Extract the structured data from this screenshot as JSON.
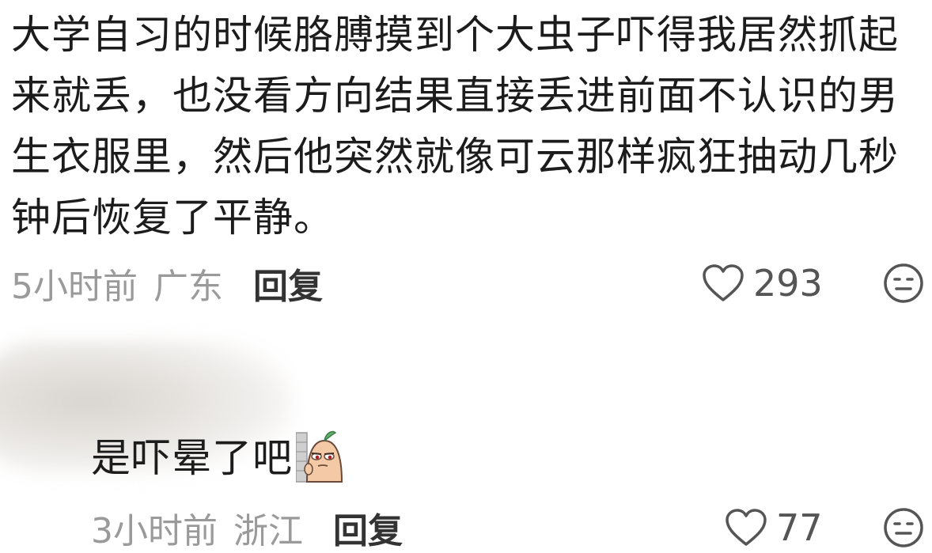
{
  "comment": {
    "text": "大学自习的时候胳膊摸到个大虫子吓得我居然抓起来就丢，也没看方向结果直接丢进前面不认识的男生衣服里，然后他突然就像可云那样疯狂抽动几秒钟后恢复了平静。",
    "time": "5小时前",
    "location": "广东",
    "reply_label": "回复",
    "like_count": "293",
    "like_icon": "heart-outline-icon",
    "emoji_icon": "meh-face-icon"
  },
  "reply": {
    "text": "是吓晕了吧",
    "sticker_icon": "peeking-character-sticker",
    "time": "3小时前",
    "location": "浙江",
    "reply_label": "回复",
    "like_count": "77",
    "like_icon": "heart-outline-icon",
    "emoji_icon": "meh-face-icon"
  },
  "colors": {
    "meta_gray": "#9a9a9a",
    "text_dark": "#1c1c1c",
    "icon_gray": "#555555"
  }
}
